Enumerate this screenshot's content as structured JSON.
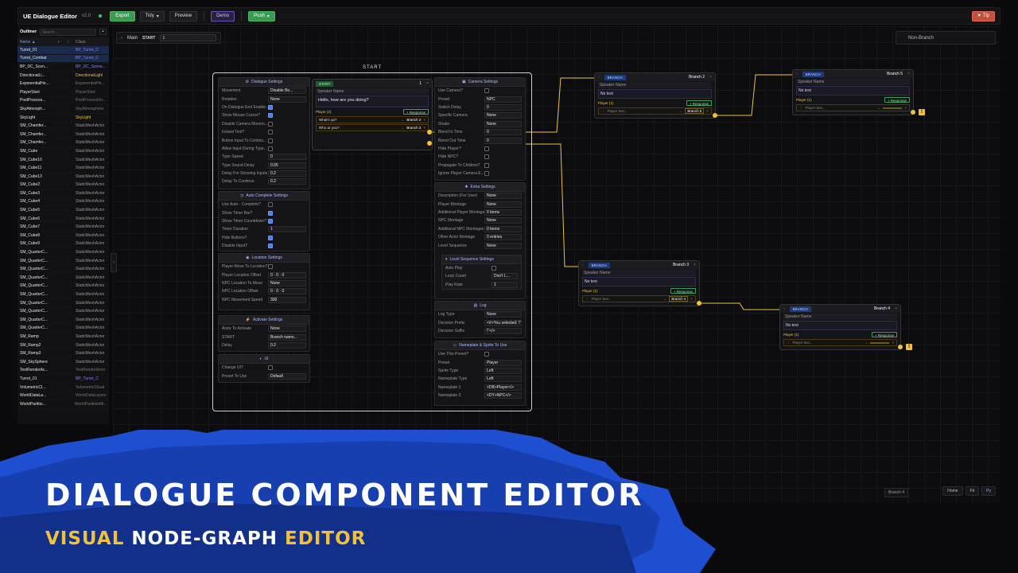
{
  "app": {
    "title": "UE Dialogue Editor",
    "version": "v2.0"
  },
  "toolbar": {
    "export": "Export",
    "tidy": "Tidy",
    "preview": "Preview",
    "demo": "Demo",
    "push": "Push",
    "tip": "Tip"
  },
  "outliner": {
    "title": "Outliner",
    "search_placeholder": "Search...",
    "col_name": "Name ▲",
    "col_class": "Class",
    "rows": [
      [
        "Turret_01",
        "BP_Turret_C",
        "bp",
        "sel"
      ],
      [
        "Turret_Combat",
        "BP_Turret_C",
        "bp",
        "sel"
      ],
      [
        "BP_DC_Scen...",
        "BP_DC_Scene...",
        "bp",
        ""
      ],
      [
        "DirectionalLi...",
        "DirectionalLight",
        "dl",
        ""
      ],
      [
        "ExponentialHe...",
        "ExponentialHe...",
        "g",
        ""
      ],
      [
        "PlayerStart",
        "PlayerStart",
        "g",
        ""
      ],
      [
        "PostProcess...",
        "PostProcessVo...",
        "g",
        ""
      ],
      [
        "SkyAtmosph...",
        "SkyAtmosphere",
        "g",
        ""
      ],
      [
        "SkyLight",
        "SkyLight",
        "sl",
        ""
      ],
      [
        "SM_Chamfer...",
        "StaticMeshActor",
        "",
        ""
      ],
      [
        "SM_Chamfer...",
        "StaticMeshActor",
        "",
        ""
      ],
      [
        "SM_Chamfer...",
        "StaticMeshActor",
        "",
        ""
      ],
      [
        "SM_Cube",
        "StaticMeshActor",
        "",
        ""
      ],
      [
        "SM_Cube10",
        "StaticMeshActor",
        "",
        ""
      ],
      [
        "SM_Cube11",
        "StaticMeshActor",
        "",
        ""
      ],
      [
        "SM_Cube13",
        "StaticMeshActor",
        "",
        ""
      ],
      [
        "SM_Cube2",
        "StaticMeshActor",
        "",
        ""
      ],
      [
        "SM_Cube3",
        "StaticMeshActor",
        "",
        ""
      ],
      [
        "SM_Cube4",
        "StaticMeshActor",
        "",
        ""
      ],
      [
        "SM_Cube5",
        "StaticMeshActor",
        "",
        ""
      ],
      [
        "SM_Cube6",
        "StaticMeshActor",
        "",
        ""
      ],
      [
        "SM_Cube7",
        "StaticMeshActor",
        "",
        ""
      ],
      [
        "SM_Cube8",
        "StaticMeshActor",
        "",
        ""
      ],
      [
        "SM_Cube9",
        "StaticMeshActor",
        "",
        ""
      ],
      [
        "SM_QuarterC...",
        "StaticMeshActor",
        "",
        ""
      ],
      [
        "SM_QuarterC...",
        "StaticMeshActor",
        "",
        ""
      ],
      [
        "SM_QuarterC...",
        "StaticMeshActor",
        "",
        ""
      ],
      [
        "SM_QuarterC...",
        "StaticMeshActor",
        "",
        ""
      ],
      [
        "SM_QuarterC...",
        "StaticMeshActor",
        "",
        ""
      ],
      [
        "SM_QuarterC...",
        "StaticMeshActor",
        "",
        ""
      ],
      [
        "SM_QuarterC...",
        "StaticMeshActor",
        "",
        ""
      ],
      [
        "SM_QuarterC...",
        "StaticMeshActor",
        "",
        ""
      ],
      [
        "SM_QuarterC...",
        "StaticMeshActor",
        "",
        ""
      ],
      [
        "SM_QuarterC...",
        "StaticMeshActor",
        "",
        ""
      ],
      [
        "SM_Ramp",
        "StaticMeshActor",
        "",
        ""
      ],
      [
        "SM_Ramp2",
        "StaticMeshActor",
        "",
        ""
      ],
      [
        "SM_Ramp3",
        "StaticMeshActor",
        "",
        ""
      ],
      [
        "SM_SkySphere",
        "StaticMeshActor",
        "",
        ""
      ],
      [
        "TextRenderAc...",
        "TextRenderActor",
        "g",
        ""
      ],
      [
        "Turret_01",
        "BP_Turret_C",
        "bp",
        ""
      ],
      [
        "VolumetricCl...",
        "VolumetricCloud",
        "g",
        ""
      ],
      [
        "WorldDataLa...",
        "WorldDataLayers",
        "g",
        ""
      ],
      [
        "WorldPartitio...",
        "WorldPartitionMi...",
        "g",
        ""
      ]
    ]
  },
  "crumb": {
    "main": "Main",
    "start": "START",
    "select": "1"
  },
  "nonbranch": "Non-Branch",
  "start_label": "START",
  "dialogue_settings": {
    "title": "Dialogue Settings",
    "rows": [
      [
        "Movement",
        "Disable Bo...",
        "v"
      ],
      [
        "Rotation",
        "None",
        "v"
      ],
      [
        "On Dialogue End Enable...",
        "on",
        "c"
      ],
      [
        "Show Mouse Cursor?",
        "on",
        "c"
      ],
      [
        "Disable Camera Movem...",
        "",
        "c"
      ],
      [
        "Instant Text?",
        "",
        "c"
      ],
      [
        "Button Input To Continu...",
        "",
        "c"
      ],
      [
        "Allow Input During Type...",
        "",
        "c"
      ],
      [
        "Type Speed",
        "0",
        "v"
      ],
      [
        "Type Sound Delay",
        "0.05",
        "v"
      ],
      [
        "Delay For Showing Inputs",
        "0.2",
        "v"
      ],
      [
        "Delay To Continue",
        "0.2",
        "v"
      ]
    ]
  },
  "auto_complete": {
    "title": "Auto Complete Settings",
    "rows": [
      [
        "Use Auto - Complete?",
        "",
        "c"
      ],
      [
        "Show Timer Bar?",
        "on",
        "c"
      ],
      [
        "Show Timer Countdown?",
        "on",
        "c"
      ],
      [
        "Timer Duration",
        "1",
        "v"
      ],
      [
        "Hide Buttons?",
        "on",
        "c"
      ],
      [
        "Disable Input?",
        "on",
        "c"
      ]
    ]
  },
  "location": {
    "title": "Location Settings",
    "rows": [
      [
        "Player Move To Location?",
        "",
        "c"
      ],
      [
        "Player Location Offset",
        "0 · 0 · 0",
        "v"
      ],
      [
        "NPC Location To Move",
        "None",
        "v"
      ],
      [
        "NPC Location Offset",
        "0 · 0 · 0",
        "v"
      ],
      [
        "NPC Movement Speed",
        "300",
        "v"
      ]
    ]
  },
  "activate": {
    "title": "Activate Settings",
    "rows": [
      [
        "Actor To Activate",
        "None",
        "v"
      ],
      [
        "START",
        "Branch name...",
        "v"
      ],
      [
        "Delay",
        "0.2",
        "v"
      ]
    ]
  },
  "ui": {
    "title": "UI",
    "rows": [
      [
        "Change UI?",
        "",
        "c"
      ],
      [
        "Preset To Use",
        "Default",
        "v"
      ]
    ]
  },
  "start_node": {
    "tag": "START",
    "num": "1",
    "speaker": "Speaker Name",
    "text": "Hello, how are you doing?",
    "player": "Player (2)",
    "response": "+ Response",
    "responses": [
      {
        "text": "What's up?",
        "branch": "Branch 2"
      },
      {
        "text": "Who ar you?",
        "branch": "Branch 3"
      }
    ]
  },
  "camera": {
    "title": "Camera Settings",
    "rows": [
      [
        "Use Camera?",
        "",
        "c"
      ],
      [
        "Preset",
        "NPC",
        "v"
      ],
      [
        "Switch Delay",
        "0",
        "v"
      ],
      [
        "Specific Camera",
        "None",
        "v"
      ],
      [
        "Shake",
        "None",
        "v"
      ],
      [
        "Blend In Time",
        "0",
        "v"
      ],
      [
        "Blend Out Time",
        "0",
        "v"
      ],
      [
        "Hide Player?",
        "",
        "c"
      ],
      [
        "Hide NPC?",
        "",
        "c"
      ],
      [
        "Propagate To Children?",
        "",
        "c"
      ],
      [
        "Ignore Player Camera E...",
        "",
        "c"
      ]
    ]
  },
  "extra": {
    "title": "Extra Settings",
    "rows": [
      [
        "Description (For User)",
        "None",
        "v"
      ],
      [
        "Player Montage",
        "None",
        "v"
      ],
      [
        "Additional Player Montages",
        "0 items",
        "v"
      ],
      [
        "NPC Montage",
        "None",
        "v"
      ],
      [
        "Additional NPC Montages",
        "0 items",
        "v"
      ],
      [
        "Other Actor Montage",
        "0 entries",
        "v"
      ],
      [
        "Level Sequence",
        "None",
        "v"
      ]
    ]
  },
  "levelseq": {
    "title": "Level Sequence Settings",
    "rows": [
      [
        "Auto Play",
        "",
        "c"
      ],
      [
        "Loop Count",
        "Don't L...",
        "v"
      ],
      [
        "Play Rate",
        "1",
        "v"
      ]
    ]
  },
  "log": {
    "title": "Log",
    "rows": [
      [
        "Log Type",
        "None",
        "v"
      ],
      [
        "Decision Prefix",
        "<#>You selected: \\\"",
        "v"
      ],
      [
        "Decision Suffix",
        "\\\"</>",
        "v"
      ]
    ]
  },
  "nameplate": {
    "title": "Nameplate & Sprite To Use",
    "rows": [
      [
        "Use This Preset?",
        "",
        "c"
      ],
      [
        "Preset",
        "Player",
        "v"
      ],
      [
        "Sprite Type",
        "Left",
        "v"
      ],
      [
        "Nameplate Type",
        "Left",
        "v"
      ],
      [
        "Nameplate 1",
        "<DB>Player</>",
        "v"
      ],
      [
        "Nameplate 2",
        "<DY>NPC</>",
        "v"
      ]
    ]
  },
  "branches": [
    {
      "id": "b2",
      "tag": "BRANCH",
      "title": "Branch 2",
      "speaker": "Speaker Name",
      "text": "No text",
      "player": "Player (1)",
      "response": "+ Response",
      "ptext": "Player text...",
      "target": "Branch 5"
    },
    {
      "id": "b5",
      "tag": "BRANCH",
      "title": "Branch 5",
      "speaker": "Speaker Name",
      "text": "No text",
      "player": "Player (1)",
      "response": "+ Response",
      "ptext": "Player text...",
      "target": ""
    },
    {
      "id": "b3",
      "tag": "BRANCH",
      "title": "Branch 3",
      "speaker": "Speaker Name",
      "text": "No text",
      "player": "Player (1)",
      "response": "+ Response",
      "ptext": "Player text...",
      "target": "Branch 4"
    },
    {
      "id": "b4",
      "tag": "BRANCH",
      "title": "Branch 4",
      "speaker": "Speaker Name",
      "text": "No text",
      "player": "Player (1)",
      "response": "+ Response",
      "ptext": "Player text...",
      "target": ""
    }
  ],
  "bottom": {
    "branch_tag": "Branch 4",
    "home": "Home",
    "fit": "Fit",
    "py": "Py"
  },
  "promo": {
    "headline": "DIALOGUE COMPONENT EDITOR",
    "sub1": "VISUAL",
    "sub2": "NODE-GRAPH",
    "sub3": "EDITOR"
  },
  "colors": {
    "accent": "#4a7df0",
    "gold": "#f0c040",
    "green": "#3a9b52",
    "banner_blue": "#1e4fd0"
  }
}
